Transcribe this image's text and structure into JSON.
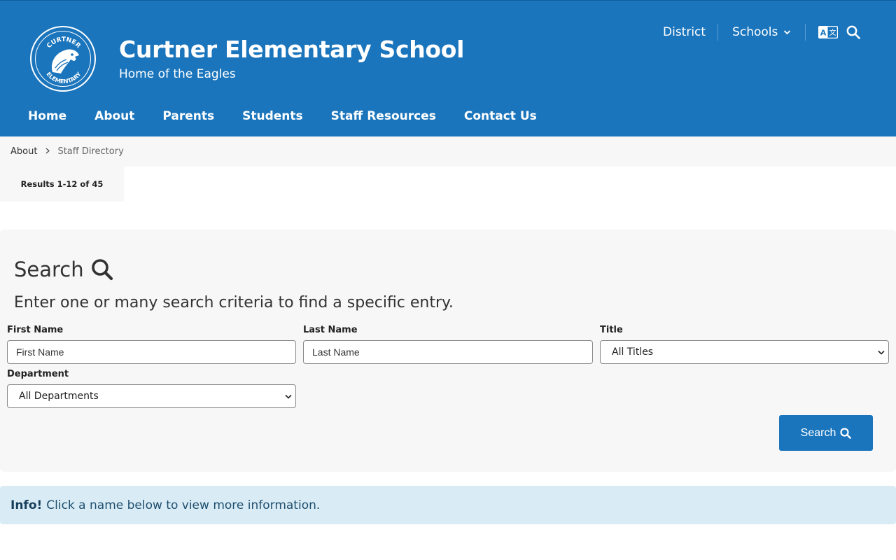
{
  "header": {
    "school_name": "Curtner Elementary School",
    "tagline": "Home of the Eagles",
    "logo_text_top": "CURTNER",
    "logo_text_bottom": "ELEMENTARY",
    "background_color": "#1b75bc"
  },
  "utility_nav": {
    "district": "District",
    "schools": "Schools",
    "translate_icon": "translate-icon",
    "search_icon": "search-icon"
  },
  "main_nav": [
    "Home",
    "About",
    "Parents",
    "Students",
    "Staff Resources",
    "Contact Us"
  ],
  "breadcrumb": {
    "parent": "About",
    "current": "Staff Directory"
  },
  "results": {
    "label": "Results 1-12 of 45"
  },
  "search_panel": {
    "heading": "Search",
    "description": "Enter one or many search criteria to find a specific entry.",
    "first_name": {
      "label": "First Name",
      "placeholder": "First Name",
      "value": ""
    },
    "last_name": {
      "label": "Last Name",
      "placeholder": "Last Name",
      "value": ""
    },
    "title": {
      "label": "Title",
      "selected": "All Titles"
    },
    "department": {
      "label": "Department",
      "selected": "All Departments"
    },
    "button_label": "Search"
  },
  "info_alert": {
    "strong": "Info!",
    "text": "Click a name below to view more information.",
    "background_color": "#d9ecf5"
  }
}
